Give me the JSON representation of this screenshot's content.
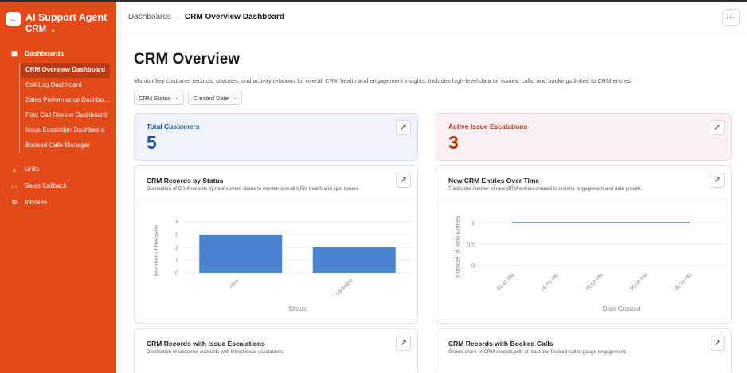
{
  "brand": {
    "title": "AI Support Agent",
    "subtitle": "CRM",
    "back_icon": "arrow-left-icon"
  },
  "sidebar": {
    "dashboards_label": "Dashboards",
    "dashboards": [
      {
        "label": "CRM Overview Dashboard",
        "active": true
      },
      {
        "label": "Call Log Dashboard",
        "active": false
      },
      {
        "label": "Sales Performance Dashboard",
        "active": false
      },
      {
        "label": "Post Call Review Dashboard",
        "active": false
      },
      {
        "label": "Issue Escalation Dashboard",
        "active": false
      },
      {
        "label": "Booked Calls Manager",
        "active": false
      }
    ],
    "items": [
      {
        "label": "Units",
        "icon": "home-icon"
      },
      {
        "label": "Sales Callback",
        "icon": "folder-icon"
      },
      {
        "label": "Inboxes",
        "icon": "gear-icon"
      }
    ]
  },
  "header": {
    "breadcrumb_root": "Dashboards",
    "breadcrumb_current": "CRM Overview Dashboard",
    "more_label": "···"
  },
  "page": {
    "title": "CRM Overview",
    "description": "Monitor key customer records, statuses, and activity relations for overall CRM health and engagement insights. Includes high-level data on issues, calls, and bookings linked to CRM entries.",
    "filters": [
      {
        "label": "CRM Status"
      },
      {
        "label": "Created Date"
      }
    ]
  },
  "stats": [
    {
      "label": "Total Customers",
      "value": "5"
    },
    {
      "label": "Active Issue Escalations",
      "value": "3"
    }
  ],
  "cards": {
    "status_chart": {
      "title": "CRM Records by Status",
      "subtitle": "Distribution of CRM records by their current status to monitor overall CRM health and spot issues."
    },
    "entries_chart": {
      "title": "New CRM Entries Over Time",
      "subtitle": "Tracks the number of new CRM entries created to monitor engagement and data growth."
    },
    "issue_escalations": {
      "title": "CRM Records with Issue Escalations",
      "subtitle": "Distribution of customer accounts with linked issue escalations"
    },
    "booked_calls": {
      "title": "CRM Records with Booked Calls",
      "subtitle": "Shows share of CRM records with at least one booked call to gauge engagement."
    }
  },
  "colors": {
    "sidebar": "#e4491a",
    "bar": "#4a86d0",
    "stat_blue": "#1d4f9c",
    "stat_red": "#b0310a"
  },
  "chart_data": [
    {
      "type": "bar",
      "categories": [
        "New",
        "Updated"
      ],
      "values": [
        3,
        2
      ],
      "xlabel": "Status",
      "ylabel": "Number of Records",
      "ylim": [
        0,
        4
      ],
      "yticks": [
        0,
        1,
        2,
        3,
        4
      ],
      "grid": true
    },
    {
      "type": "line",
      "x": [
        "03:41 PM",
        "05:55 PM",
        "06:02 PM",
        "09:08 PM",
        "09:33 PM"
      ],
      "values": [
        1,
        1,
        1,
        1,
        1
      ],
      "xlabel": "Date Created",
      "ylabel": "Number of New Entries",
      "ylim": [
        0,
        1
      ],
      "yticks": [
        0,
        0.5,
        1
      ],
      "grid": true
    }
  ]
}
